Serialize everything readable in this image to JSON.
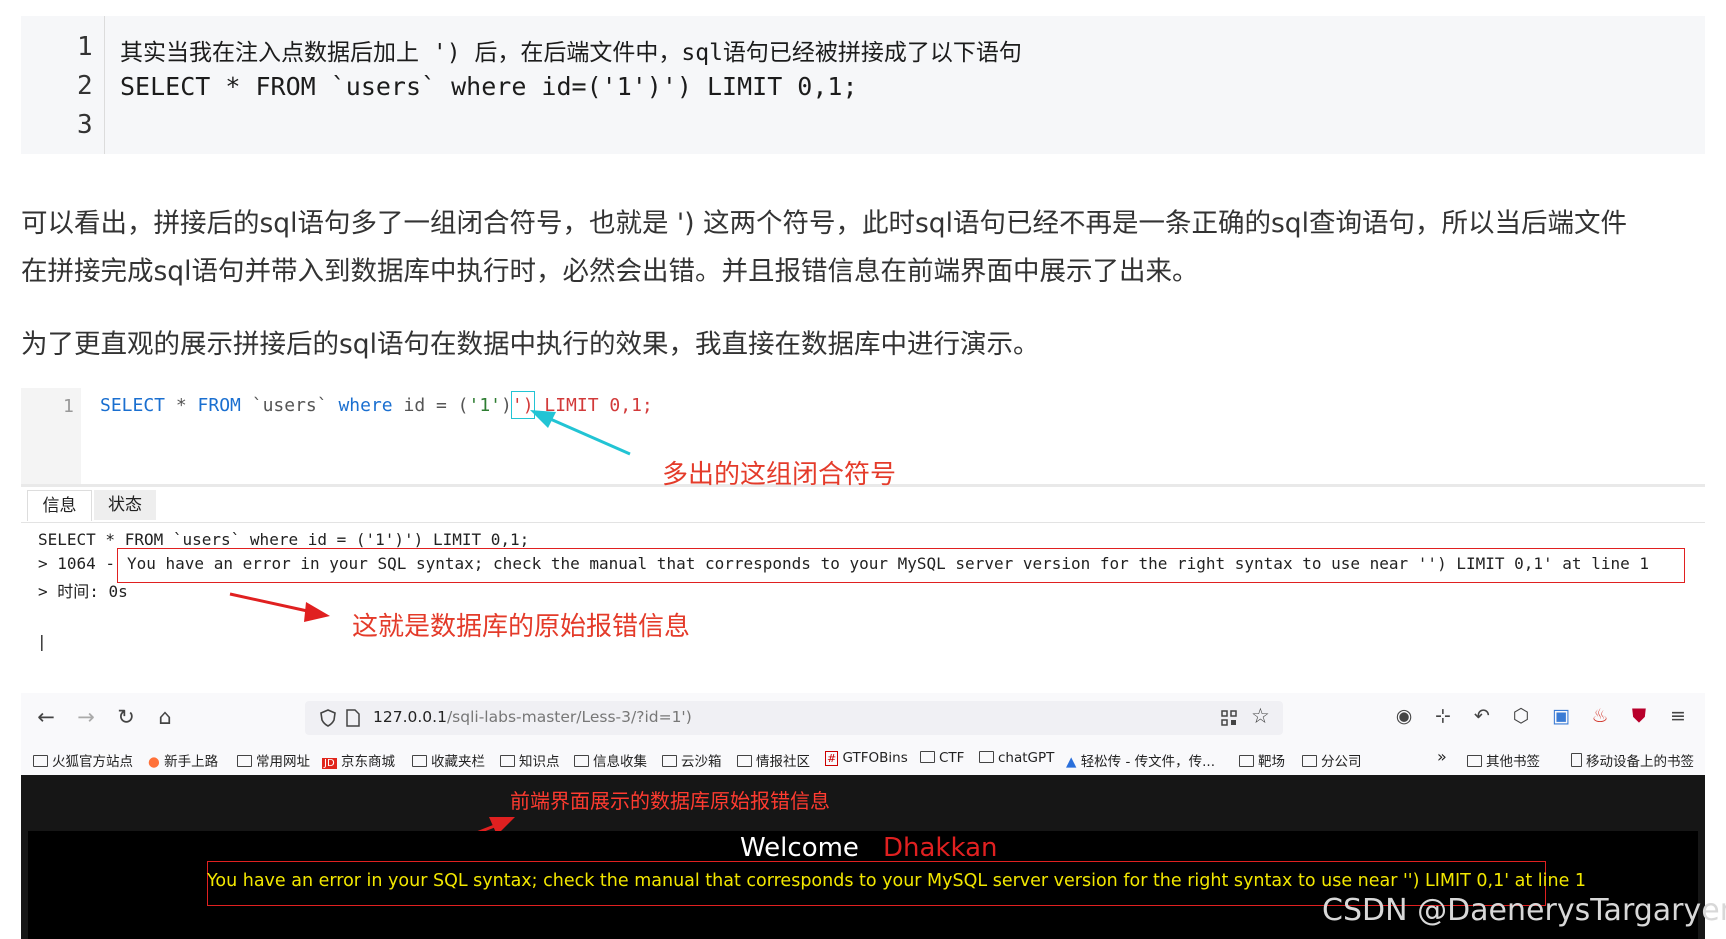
{
  "code_block": {
    "line_numbers": [
      "1",
      "2",
      "3"
    ],
    "lines": [
      "其实当我在注入点数据后加上 ') 后，在后端文件中，sql语句已经被拼接成了以下语句",
      "SELECT * FROM `users` where id=('1')') LIMIT 0,1;",
      ""
    ]
  },
  "paragraphs": [
    "可以看出，拼接后的sql语句多了一组闭合符号，也就是 ') 这两个符号，此时sql语句已经不再是一条正确的sql查询语句，所以当后端文件",
    "在拼接完成sql语句并带入到数据库中执行时，必然会出错。并且报错信息在前端界面中展示了出来。",
    "为了更直观的展示拼接后的sql语句在数据中执行的效果，我直接在数据库中进行演示。"
  ],
  "editor": {
    "line_number": "1",
    "tokens": {
      "select": "SELECT",
      "star": " * ",
      "from": "FROM",
      "table": " `users` ",
      "where": "where",
      "cond": " id = (",
      "val": "'1'",
      "close1": ")",
      "extra": "')",
      "limit": " LIMIT 0,1;"
    },
    "annotation": "多出的这组闭合符号"
  },
  "result_panel": {
    "tabs": [
      "信息",
      "状态"
    ],
    "lines": [
      "SELECT * FROM `users` where id = ('1')') LIMIT 0,1;",
      "> 1064 - ",
      "> 时间: 0s"
    ],
    "error": "You have an error in your SQL syntax; check the manual that corresponds to your MySQL server version for the right syntax to use near '') LIMIT 0,1' at line 1",
    "annotation": "这就是数据库的原始报错信息",
    "cursor": "|"
  },
  "browser": {
    "url_host": "127.0.0.1",
    "url_path": "/sqli-labs-master/Less-3/?id=1')",
    "bookmarks": [
      "火狐官方站点",
      "新手上路",
      "常用网址",
      "京东商城",
      "收藏夹栏",
      "知识点",
      "信息收集",
      "云沙箱",
      "情报社区",
      "GTFOBins",
      "CTF",
      "chatGPT",
      "轻松传 - 传文件，传...",
      "靶场",
      "分公司"
    ],
    "bookmarks_right": [
      "其他书签",
      "移动设备上的书签"
    ],
    "page_annotation": "前端界面展示的数据库原始报错信息",
    "welcome": "Welcome",
    "name": "Dhakkan",
    "error": "You have an error in your SQL syntax; check the manual that corresponds to your MySQL server version for the right syntax to use near '') LIMIT 0,1' at line 1"
  },
  "watermark": "CSDN @DaenerysTargaryen",
  "colors": {
    "annotation_red": "#e43b2a",
    "keyword_blue": "#1a6fd0",
    "box_red": "#e02020",
    "box_cyan": "#22c4d4",
    "error_yellow": "#f2e700"
  }
}
